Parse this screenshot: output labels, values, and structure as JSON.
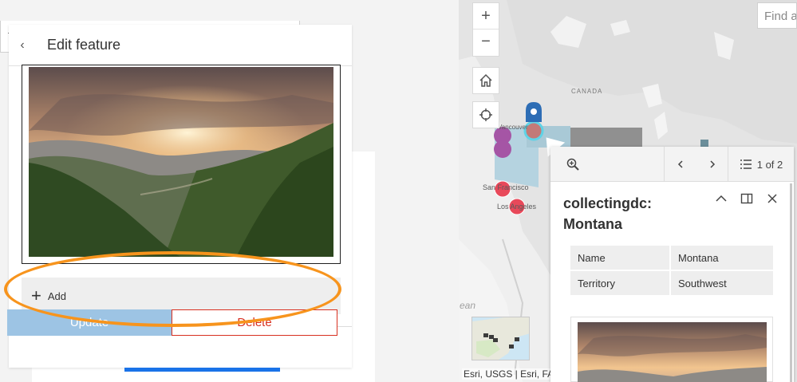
{
  "edit_panel": {
    "title": "Edit feature",
    "back_label": "‹",
    "add_label": "Add",
    "add_icon": "+",
    "update_label": "Update",
    "delete_label": "Delete"
  },
  "top_fragment": {
    "mark": "·"
  },
  "map": {
    "zoom_in": "+",
    "zoom_out": "−",
    "search_placeholder": "Find a",
    "labels": {
      "canada": "CANADA",
      "vancouver": "Vancouver",
      "san_francisco": "San Francisco",
      "los_angeles": "Los Angeles",
      "ocean": "ean"
    },
    "attribution": "Esri, USGS | Esri, FA"
  },
  "popup": {
    "pager": "1 of 2",
    "title": "collectingdc: Montana",
    "attributes": [
      {
        "key": "Name",
        "value": "Montana"
      },
      {
        "key": "Territory",
        "value": "Southwest"
      }
    ]
  },
  "colors": {
    "accent": "#1a73e8",
    "update_bg": "#9dc4e4",
    "delete": "#d83020",
    "highlight": "#f7941d",
    "marker_purple": "#a555a5",
    "marker_red": "#e8495a",
    "marker_selected": "#c27a78",
    "pin_blue": "#2d6db5"
  }
}
